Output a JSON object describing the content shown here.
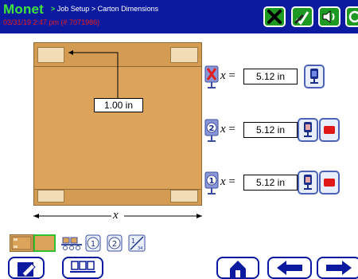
{
  "header": {
    "brand": "Monet",
    "breadcrumb_sep": ">",
    "breadcrumb": "Job Setup > Carton Dimensions",
    "status": "03/31/19  2:47 pm  (# 7071986)"
  },
  "header_buttons": [
    {
      "name": "cancel-button",
      "icon": "x-icon"
    },
    {
      "name": "accept-button",
      "icon": "edit-check-icon"
    },
    {
      "name": "sound-button",
      "icon": "speaker-icon"
    },
    {
      "name": "refresh-button",
      "icon": "refresh-icon"
    }
  ],
  "diagram": {
    "measurement": "1.00 in",
    "x_axis": "x"
  },
  "sensors": [
    {
      "id": "sensor-x",
      "icon": "sensor-disabled-icon",
      "var": "x",
      "equals": "=",
      "value": "5.12 in",
      "has_stop": false
    },
    {
      "id": "sensor-2",
      "icon": "sensor-2-icon",
      "var": "x",
      "equals": "=",
      "value": "5.12 in",
      "has_stop": true
    },
    {
      "id": "sensor-1",
      "icon": "sensor-1-icon",
      "var": "x",
      "equals": "=",
      "value": "5.12 in",
      "has_stop": true
    }
  ],
  "toolbar": {
    "items": [
      "carton-icon",
      "box-icon",
      "conveyor-icon",
      "sensor-1-icon",
      "sensor-2-icon",
      "measure-icon"
    ],
    "measure_label": "1",
    "measure_sub": "34"
  },
  "nav": {
    "items": [
      "edit-icon",
      "conveyor-icon",
      "home-icon",
      "back-icon",
      "forward-icon"
    ]
  },
  "colors": {
    "header_bg": "#0b1a9e",
    "brand": "#3fe33f",
    "status": "#e81f1f",
    "carton": "#dca45a"
  }
}
